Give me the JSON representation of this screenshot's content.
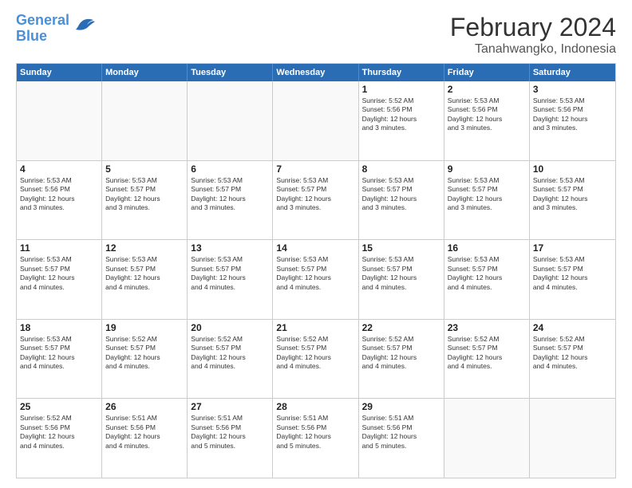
{
  "logo": {
    "line1": "General",
    "line2": "Blue"
  },
  "title": "February 2024",
  "location": "Tanahwangko, Indonesia",
  "days_of_week": [
    "Sunday",
    "Monday",
    "Tuesday",
    "Wednesday",
    "Thursday",
    "Friday",
    "Saturday"
  ],
  "weeks": [
    [
      {
        "day": "",
        "info": ""
      },
      {
        "day": "",
        "info": ""
      },
      {
        "day": "",
        "info": ""
      },
      {
        "day": "",
        "info": ""
      },
      {
        "day": "1",
        "info": "Sunrise: 5:52 AM\nSunset: 5:56 PM\nDaylight: 12 hours\nand 3 minutes."
      },
      {
        "day": "2",
        "info": "Sunrise: 5:53 AM\nSunset: 5:56 PM\nDaylight: 12 hours\nand 3 minutes."
      },
      {
        "day": "3",
        "info": "Sunrise: 5:53 AM\nSunset: 5:56 PM\nDaylight: 12 hours\nand 3 minutes."
      }
    ],
    [
      {
        "day": "4",
        "info": "Sunrise: 5:53 AM\nSunset: 5:56 PM\nDaylight: 12 hours\nand 3 minutes."
      },
      {
        "day": "5",
        "info": "Sunrise: 5:53 AM\nSunset: 5:57 PM\nDaylight: 12 hours\nand 3 minutes."
      },
      {
        "day": "6",
        "info": "Sunrise: 5:53 AM\nSunset: 5:57 PM\nDaylight: 12 hours\nand 3 minutes."
      },
      {
        "day": "7",
        "info": "Sunrise: 5:53 AM\nSunset: 5:57 PM\nDaylight: 12 hours\nand 3 minutes."
      },
      {
        "day": "8",
        "info": "Sunrise: 5:53 AM\nSunset: 5:57 PM\nDaylight: 12 hours\nand 3 minutes."
      },
      {
        "day": "9",
        "info": "Sunrise: 5:53 AM\nSunset: 5:57 PM\nDaylight: 12 hours\nand 3 minutes."
      },
      {
        "day": "10",
        "info": "Sunrise: 5:53 AM\nSunset: 5:57 PM\nDaylight: 12 hours\nand 3 minutes."
      }
    ],
    [
      {
        "day": "11",
        "info": "Sunrise: 5:53 AM\nSunset: 5:57 PM\nDaylight: 12 hours\nand 4 minutes."
      },
      {
        "day": "12",
        "info": "Sunrise: 5:53 AM\nSunset: 5:57 PM\nDaylight: 12 hours\nand 4 minutes."
      },
      {
        "day": "13",
        "info": "Sunrise: 5:53 AM\nSunset: 5:57 PM\nDaylight: 12 hours\nand 4 minutes."
      },
      {
        "day": "14",
        "info": "Sunrise: 5:53 AM\nSunset: 5:57 PM\nDaylight: 12 hours\nand 4 minutes."
      },
      {
        "day": "15",
        "info": "Sunrise: 5:53 AM\nSunset: 5:57 PM\nDaylight: 12 hours\nand 4 minutes."
      },
      {
        "day": "16",
        "info": "Sunrise: 5:53 AM\nSunset: 5:57 PM\nDaylight: 12 hours\nand 4 minutes."
      },
      {
        "day": "17",
        "info": "Sunrise: 5:53 AM\nSunset: 5:57 PM\nDaylight: 12 hours\nand 4 minutes."
      }
    ],
    [
      {
        "day": "18",
        "info": "Sunrise: 5:53 AM\nSunset: 5:57 PM\nDaylight: 12 hours\nand 4 minutes."
      },
      {
        "day": "19",
        "info": "Sunrise: 5:52 AM\nSunset: 5:57 PM\nDaylight: 12 hours\nand 4 minutes."
      },
      {
        "day": "20",
        "info": "Sunrise: 5:52 AM\nSunset: 5:57 PM\nDaylight: 12 hours\nand 4 minutes."
      },
      {
        "day": "21",
        "info": "Sunrise: 5:52 AM\nSunset: 5:57 PM\nDaylight: 12 hours\nand 4 minutes."
      },
      {
        "day": "22",
        "info": "Sunrise: 5:52 AM\nSunset: 5:57 PM\nDaylight: 12 hours\nand 4 minutes."
      },
      {
        "day": "23",
        "info": "Sunrise: 5:52 AM\nSunset: 5:57 PM\nDaylight: 12 hours\nand 4 minutes."
      },
      {
        "day": "24",
        "info": "Sunrise: 5:52 AM\nSunset: 5:57 PM\nDaylight: 12 hours\nand 4 minutes."
      }
    ],
    [
      {
        "day": "25",
        "info": "Sunrise: 5:52 AM\nSunset: 5:56 PM\nDaylight: 12 hours\nand 4 minutes."
      },
      {
        "day": "26",
        "info": "Sunrise: 5:51 AM\nSunset: 5:56 PM\nDaylight: 12 hours\nand 4 minutes."
      },
      {
        "day": "27",
        "info": "Sunrise: 5:51 AM\nSunset: 5:56 PM\nDaylight: 12 hours\nand 5 minutes."
      },
      {
        "day": "28",
        "info": "Sunrise: 5:51 AM\nSunset: 5:56 PM\nDaylight: 12 hours\nand 5 minutes."
      },
      {
        "day": "29",
        "info": "Sunrise: 5:51 AM\nSunset: 5:56 PM\nDaylight: 12 hours\nand 5 minutes."
      },
      {
        "day": "",
        "info": ""
      },
      {
        "day": "",
        "info": ""
      }
    ]
  ]
}
